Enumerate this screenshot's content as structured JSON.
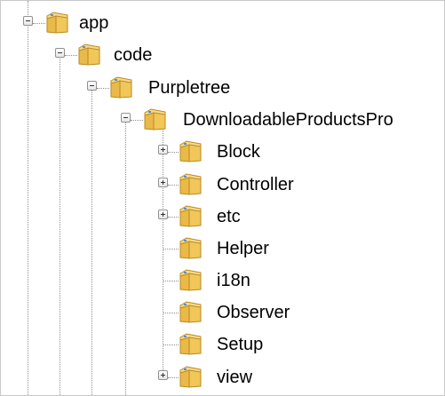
{
  "tree": {
    "app": "app",
    "code": "code",
    "purpletree": "Purpletree",
    "module": "DownloadableProductsPro",
    "children": [
      {
        "label": "Block",
        "expandable": true
      },
      {
        "label": "Controller",
        "expandable": true
      },
      {
        "label": "etc",
        "expandable": true
      },
      {
        "label": "Helper",
        "expandable": false
      },
      {
        "label": "i18n",
        "expandable": false
      },
      {
        "label": "Observer",
        "expandable": false
      },
      {
        "label": "Setup",
        "expandable": false
      },
      {
        "label": "view",
        "expandable": true
      }
    ]
  },
  "colors": {
    "folder_body": "#e9b949",
    "folder_back": "#f6d98a",
    "folder_edge": "#b98a1f",
    "connector": "#8f8f8f"
  },
  "icons": {
    "folder": "folder-icon",
    "expand": "expand-plus-icon",
    "collapse": "collapse-minus-icon"
  }
}
